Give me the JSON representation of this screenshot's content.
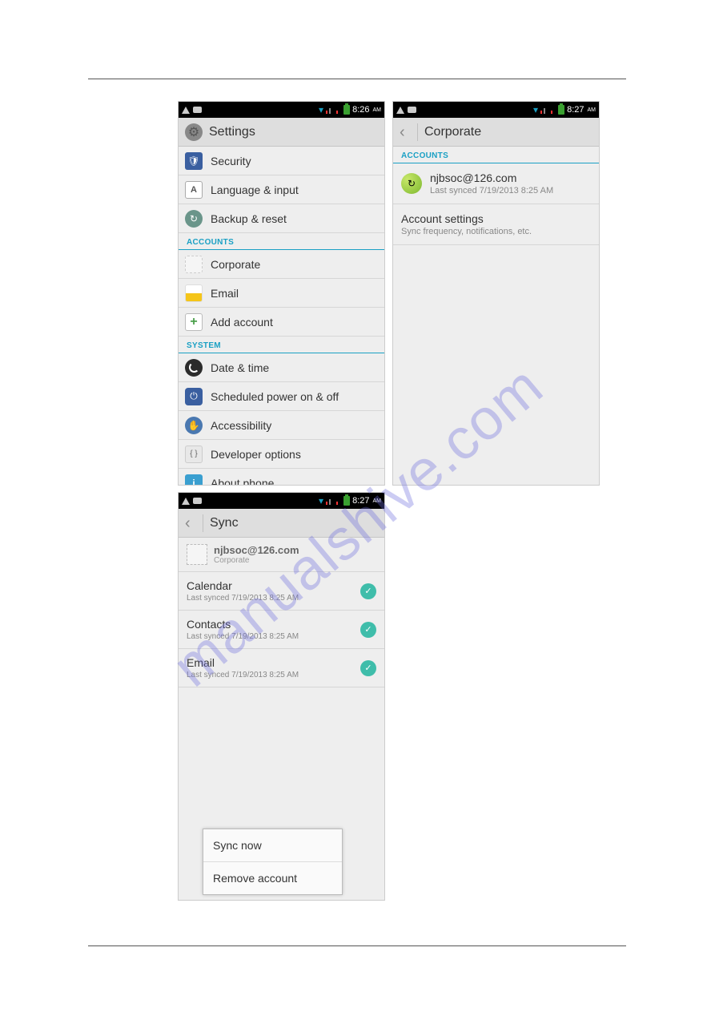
{
  "watermark": "manualshive.com",
  "screenshots": {
    "settings": {
      "time": "8:26",
      "ampm": "AM",
      "title": "Settings",
      "items_top": [
        {
          "label": "Security"
        },
        {
          "label": "Language & input"
        },
        {
          "label": "Backup & reset"
        }
      ],
      "section_accounts": "ACCOUNTS",
      "accounts": [
        {
          "label": "Corporate"
        },
        {
          "label": "Email"
        },
        {
          "label": "Add account"
        }
      ],
      "section_system": "SYSTEM",
      "system": [
        {
          "label": "Date & time"
        },
        {
          "label": "Scheduled power on & off"
        },
        {
          "label": "Accessibility"
        },
        {
          "label": "Developer options"
        },
        {
          "label": "About phone"
        }
      ]
    },
    "corporate": {
      "time": "8:27",
      "ampm": "AM",
      "title": "Corporate",
      "section_accounts": "ACCOUNTS",
      "account": {
        "email": "njbsoc@126.com",
        "subtitle": "Last synced 7/19/2013 8:25 AM"
      },
      "settings_row": {
        "title": "Account settings",
        "subtitle": "Sync frequency, notifications, etc."
      }
    },
    "sync": {
      "time": "8:27",
      "ampm": "AM",
      "title": "Sync",
      "header": {
        "line1": "njbsoc@126.com",
        "line2": "Corporate"
      },
      "items": [
        {
          "label": "Calendar",
          "sub": "Last synced 7/19/2013 8:25 AM"
        },
        {
          "label": "Contacts",
          "sub": "Last synced 7/19/2013 8:25 AM"
        },
        {
          "label": "Email",
          "sub": "Last synced 7/19/2013 8:25 AM"
        }
      ],
      "menu": {
        "sync_now": "Sync now",
        "remove": "Remove account"
      }
    }
  }
}
